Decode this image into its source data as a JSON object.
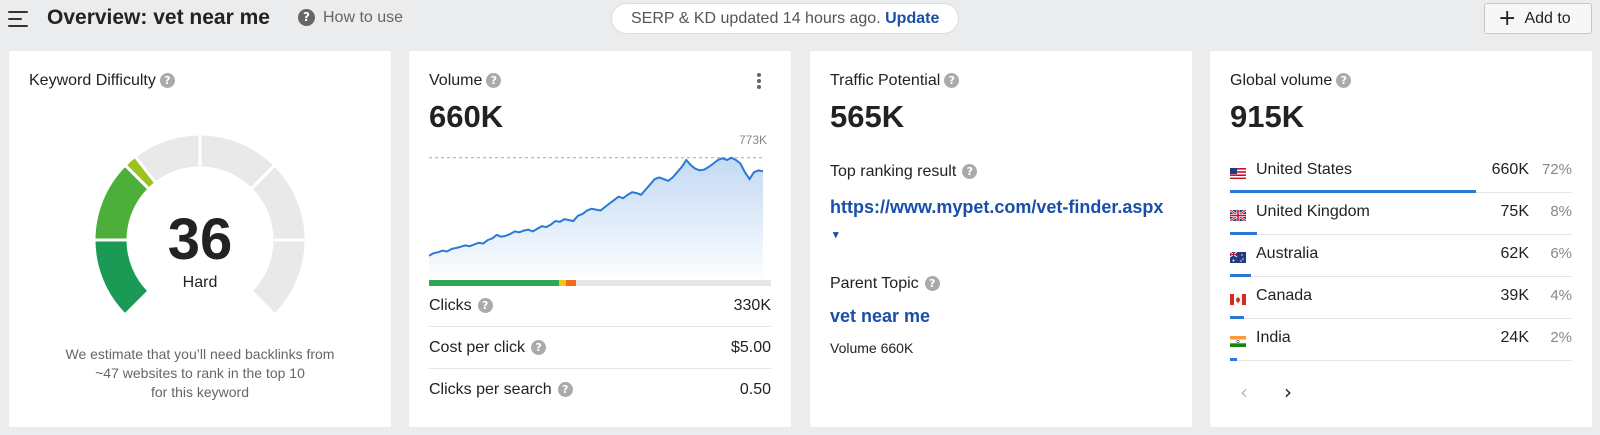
{
  "header": {
    "title": "Overview: vet near me",
    "how_to_use": "How to use",
    "status_text": "SERP & KD updated 14 hours ago.",
    "update_link": "Update",
    "add_button": "Add to"
  },
  "keyword_difficulty": {
    "title": "Keyword Difficulty",
    "value": "36",
    "level": "Hard",
    "note_line1": "We estimate that you’ll need backlinks from",
    "note_line2": "~47 websites to rank in the top 10",
    "note_line3": "for this keyword",
    "gauge_fraction": 0.36
  },
  "volume": {
    "title": "Volume",
    "value": "660K",
    "peak_label": "773K",
    "click_split": {
      "organic_pct": 38,
      "yellow_pct": 2,
      "paid_pct": 3
    },
    "metrics": [
      {
        "label": "Clicks",
        "value": "330K"
      },
      {
        "label": "Cost per click",
        "value": "$5.00"
      },
      {
        "label": "Clicks per search",
        "value": "0.50"
      }
    ]
  },
  "chart_data": {
    "type": "area",
    "title": "",
    "xlabel": "",
    "ylabel": "",
    "annotations": [
      "773K"
    ],
    "values": [
      210,
      225,
      230,
      240,
      235,
      250,
      255,
      262,
      270,
      265,
      275,
      285,
      280,
      300,
      310,
      330,
      320,
      325,
      335,
      350,
      345,
      355,
      360,
      350,
      365,
      380,
      375,
      390,
      410,
      405,
      420,
      415,
      410,
      440,
      450,
      470,
      480,
      475,
      470,
      490,
      510,
      530,
      550,
      540,
      560,
      575,
      570,
      560,
      590,
      620,
      650,
      660,
      650,
      640,
      660,
      690,
      720,
      760,
      730,
      710,
      700,
      705,
      720,
      740,
      760,
      770,
      760,
      773,
      760,
      740,
      690,
      650,
      690,
      700,
      695
    ],
    "ylim": [
      100,
      800
    ],
    "grid": false
  },
  "traffic_potential": {
    "title": "Traffic Potential",
    "value": "565K",
    "top_result_title": "Top ranking result",
    "top_result_url": "https://www.mypet.com/vet-finder.aspx",
    "caret": "▾",
    "parent_topic_title": "Parent Topic",
    "parent_topic": "vet near me",
    "parent_volume": "Volume 660K"
  },
  "global_volume": {
    "title": "Global volume",
    "value": "915K",
    "countries": [
      {
        "name": "United States",
        "volume": "660K",
        "pct": "72%",
        "flag": "us-flag-icon",
        "share": 0.72
      },
      {
        "name": "United Kingdom",
        "volume": "75K",
        "pct": "8%",
        "flag": "uk-flag-icon",
        "share": 0.08
      },
      {
        "name": "Australia",
        "volume": "62K",
        "pct": "6%",
        "flag": "au-flag-icon",
        "share": 0.06
      },
      {
        "name": "Canada",
        "volume": "39K",
        "pct": "4%",
        "flag": "ca-flag-icon",
        "share": 0.04
      },
      {
        "name": "India",
        "volume": "24K",
        "pct": "2%",
        "flag": "in-flag-icon",
        "share": 0.02
      }
    ],
    "prev": "‹",
    "next": "›"
  },
  "colors": {
    "link": "#1a4fa8",
    "chart_line": "#2979d5",
    "gauge_bg": "#e9e9e9",
    "kd_green_dark": "#1a9a55",
    "kd_green": "#4caf3a",
    "kd_yellowgreen": "#9bc31d"
  }
}
